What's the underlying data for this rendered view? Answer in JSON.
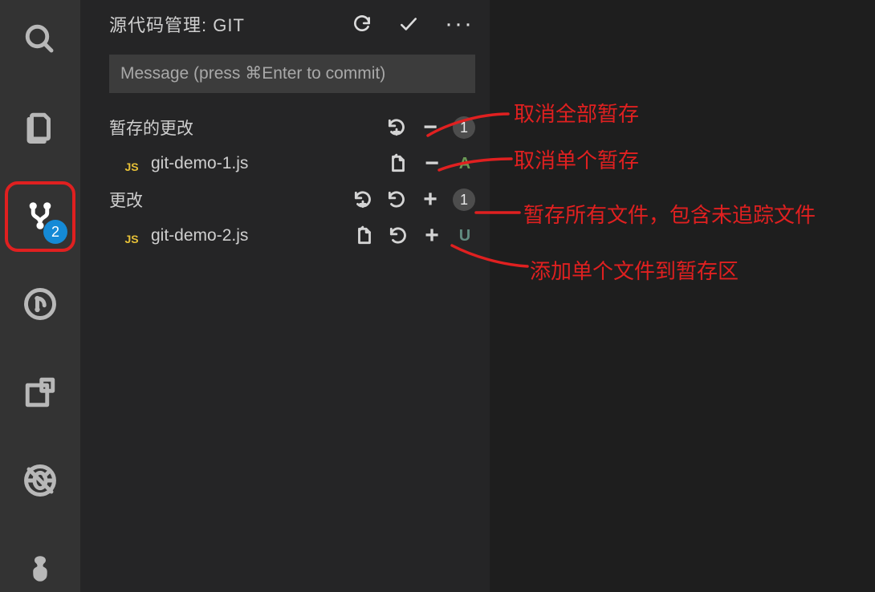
{
  "activitybar": {
    "search": "search",
    "files": "files",
    "scm": "source-control",
    "scm_badge": "2",
    "git": "git",
    "extensions": "extensions",
    "debug": "debug",
    "tree": "plugin-tree"
  },
  "panel": {
    "title": "源代码管理: GIT",
    "commit_placeholder": "Message (press ⌘Enter to commit)",
    "staged": {
      "label": "暂存的更改",
      "count": "1",
      "files": [
        {
          "name": "git-demo-1.js",
          "status": "A"
        }
      ]
    },
    "changes": {
      "label": "更改",
      "count": "1",
      "files": [
        {
          "name": "git-demo-2.js",
          "status": "U"
        }
      ]
    }
  },
  "annotations": {
    "unstage_all": "取消全部暂存",
    "unstage_one": "取消单个暂存",
    "stage_all": "暂存所有文件，包含未追踪文件",
    "stage_one": "添加单个文件到暂存区"
  }
}
